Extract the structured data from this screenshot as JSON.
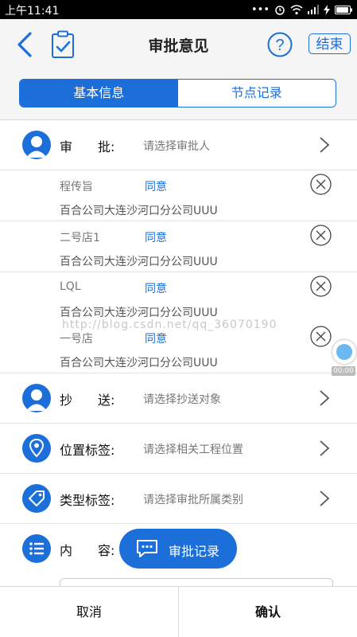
{
  "status_bar": {
    "time": "上午11:41",
    "battery": "▮"
  },
  "header": {
    "title": "审批意见",
    "finish_label": "结束"
  },
  "tabs": [
    {
      "label": "基本信息",
      "active": true
    },
    {
      "label": "节点记录",
      "active": false
    }
  ],
  "approver_row": {
    "label": "审　　批:",
    "hint": "请选择审批人"
  },
  "approvals": [
    {
      "name": "程传旨",
      "status": "同意",
      "org": "百合公司大连沙河口分公司UUU"
    },
    {
      "name": "二号店1",
      "status": "同意",
      "org": "百合公司大连沙河口分公司UUU"
    },
    {
      "name": "LQL",
      "status": "同意",
      "org": "百合公司大连沙河口分公司UUU"
    },
    {
      "name": "一号店",
      "status": "同意",
      "org": "百合公司大连沙河口分公司UUU"
    }
  ],
  "cc_row": {
    "label": "抄　　送:",
    "hint": "请选择抄送对象"
  },
  "location_row": {
    "label": "位置标签:",
    "hint": "请选择相关工程位置"
  },
  "type_row": {
    "label": "类型标签:",
    "hint": "请选择审批所属类别"
  },
  "content_row": {
    "label": "内　　容:"
  },
  "fab": {
    "label": "审批记录"
  },
  "watermark": "http://blog.csdn.net/qq_36070190",
  "float_time": "00:00",
  "bottom": {
    "cancel_label": "取消",
    "confirm_label": "确认"
  },
  "colors": {
    "accent": "#1c6fd9"
  }
}
